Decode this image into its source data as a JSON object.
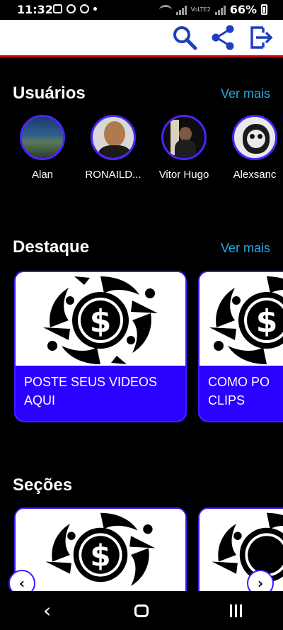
{
  "status_bar": {
    "time": "11:32",
    "network_label": "VoLTE2",
    "battery_percent": "66%"
  },
  "header": {
    "actions": [
      {
        "icon": "search-icon"
      },
      {
        "icon": "share-icon"
      },
      {
        "icon": "logout-icon"
      }
    ],
    "accent_color": "#1d3fbf",
    "border_color": "#d40000"
  },
  "usuarios": {
    "title": "Usuários",
    "ver_mais": "Ver mais",
    "users": [
      {
        "name": "Alan"
      },
      {
        "name": "RONAILD..."
      },
      {
        "name": "Vitor Hugo"
      },
      {
        "name": "Alexsanc"
      }
    ]
  },
  "destaque": {
    "title": "Destaque",
    "ver_mais": "Ver mais",
    "cards": [
      {
        "line1": "POSTE SEUS VIDEOS",
        "line2": "AQUI"
      },
      {
        "line1": "COMO PO",
        "line2": "CLIPS"
      }
    ]
  },
  "secoes": {
    "title": "Seções"
  },
  "colors": {
    "card_label_bg": "#2b00ff",
    "link": "#29a8e0",
    "avatar_border": "#4c23ff"
  }
}
